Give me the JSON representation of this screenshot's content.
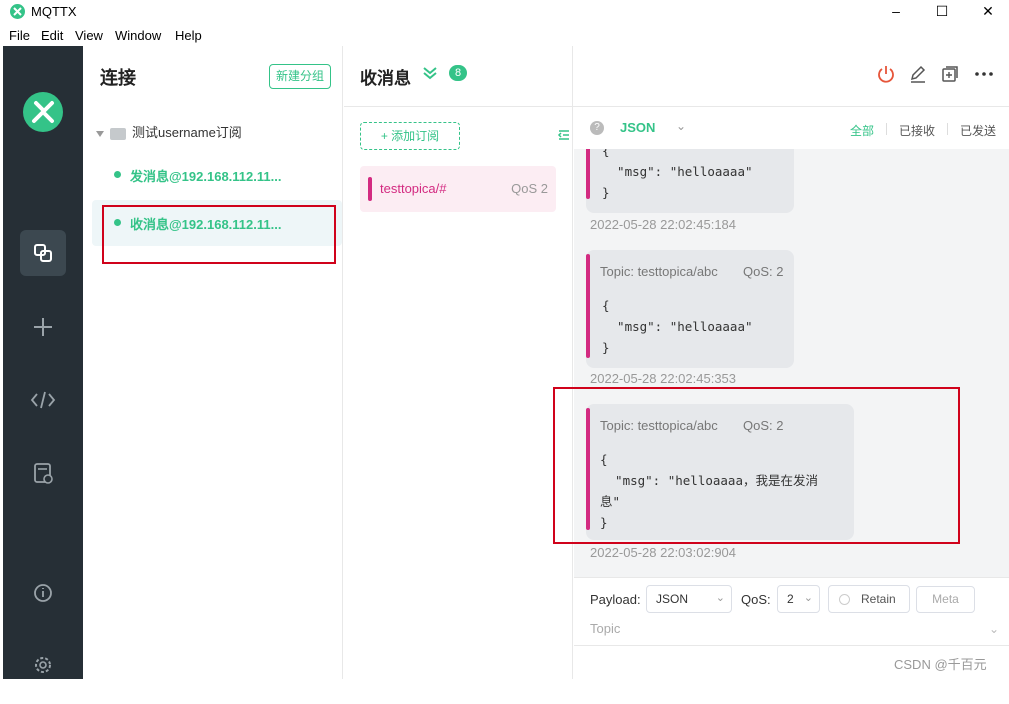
{
  "window": {
    "title": "MQTTX"
  },
  "menu": [
    "File",
    "Edit",
    "View",
    "Window",
    "Help"
  ],
  "sidebar_icons": [
    "logo-icon",
    "connections-icon",
    "add-icon",
    "script-icon",
    "log-icon",
    "about-icon",
    "settings-icon"
  ],
  "connections": {
    "title": "连接",
    "new_group": "新建分组",
    "group": "测试username订阅",
    "items": [
      {
        "label": "发消息@192.168.112.11..."
      },
      {
        "label": "收消息@192.168.112.11..."
      }
    ]
  },
  "subscriptions": {
    "title": "收消息",
    "unread_count": "8",
    "add_label": "添加订阅",
    "topics": [
      {
        "name": "testtopica/#",
        "qos": "QoS 2",
        "color": "#d32b81"
      }
    ]
  },
  "filter": {
    "format": "JSON",
    "tabs": [
      "全部",
      "已接收",
      "已发送"
    ]
  },
  "messages": [
    {
      "topic": "",
      "qos": "",
      "body": "{\n  \"msg\": \"helloaaaa\"\n}",
      "time": "2022-05-28 22:02:45:184"
    },
    {
      "topic": "Topic: testtopica/abc",
      "qos": "QoS: 2",
      "body": "{\n  \"msg\": \"helloaaaa\"\n}",
      "time": "2022-05-28 22:02:45:353"
    },
    {
      "topic": "Topic: testtopica/abc",
      "qos": "QoS: 2",
      "body": "{\n  \"msg\": \"helloaaaa，我是在发消\n息\"\n}",
      "time": "2022-05-28 22:03:02:904"
    }
  ],
  "publish": {
    "payload_label": "Payload:",
    "payload_format": "JSON",
    "qos_label": "QoS:",
    "qos_value": "2",
    "retain_label": "Retain",
    "meta_label": "Meta",
    "topic_placeholder": "Topic"
  },
  "watermark": "CSDN @千百元",
  "colors": {
    "accent": "#34c388",
    "topic": "#d32b81",
    "sidebar": "#262f36",
    "annotation": "#d0021b"
  }
}
